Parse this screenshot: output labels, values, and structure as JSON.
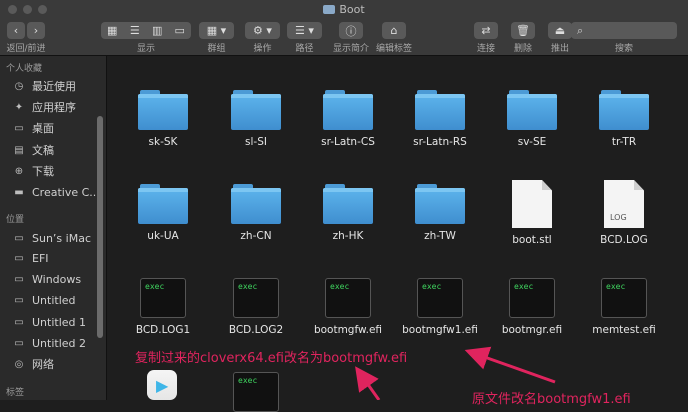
{
  "window": {
    "title": "Boot"
  },
  "toolbar": {
    "back_forward_label": "返回/前进",
    "display_label": "显示",
    "group_label": "群组",
    "action_label": "操作",
    "path_label": "路径",
    "preview_label": "显示简介",
    "edit_tags_label": "编辑标签",
    "connect_label": "连接",
    "delete_label": "删除",
    "eject_label": "推出",
    "search_label": "搜索"
  },
  "sidebar": {
    "favorites_header": "个人收藏",
    "favorites": [
      {
        "label": "最近使用",
        "icon": "clock-icon"
      },
      {
        "label": "应用程序",
        "icon": "apps-icon"
      },
      {
        "label": "桌面",
        "icon": "desktop-icon"
      },
      {
        "label": "文稿",
        "icon": "document-icon"
      },
      {
        "label": "下载",
        "icon": "download-icon"
      },
      {
        "label": "Creative C...",
        "icon": "folder-icon"
      }
    ],
    "locations_header": "位置",
    "locations": [
      {
        "label": "Sun’s iMac",
        "icon": "computer-icon"
      },
      {
        "label": "EFI",
        "icon": "disk-icon"
      },
      {
        "label": "Windows",
        "icon": "disk-icon"
      },
      {
        "label": "Untitled",
        "icon": "disk-icon"
      },
      {
        "label": "Untitled 1",
        "icon": "disk-icon"
      },
      {
        "label": "Untitled 2",
        "icon": "disk-icon"
      },
      {
        "label": "网络",
        "icon": "network-icon"
      }
    ],
    "tags_header": "标签"
  },
  "files": {
    "row1": [
      "sk-SK",
      "sl-SI",
      "sr-Latn-CS",
      "sr-Latn-RS",
      "sv-SE",
      "tr-TR"
    ],
    "row2": [
      "uk-UA",
      "zh-CN",
      "zh-HK",
      "zh-TW",
      "boot.stl",
      "BCD.LOG"
    ],
    "row3": [
      "BCD.LOG1",
      "BCD.LOG2",
      "bootmgfw.efi",
      "bootmgfw1.efi",
      "bootmgr.efi",
      "memtest.efi"
    ],
    "exec_text": "exec",
    "log_text": "LOG"
  },
  "annotations": {
    "copy_note": "复制过来的cloverx64.efi改名为bootmgfw.efi",
    "rename_note": "原文件改名bootmgfw1.efi"
  },
  "colors": {
    "annotation": "#e0245e",
    "folder": "#4c9bd6",
    "exec_text": "#3fd45f"
  }
}
